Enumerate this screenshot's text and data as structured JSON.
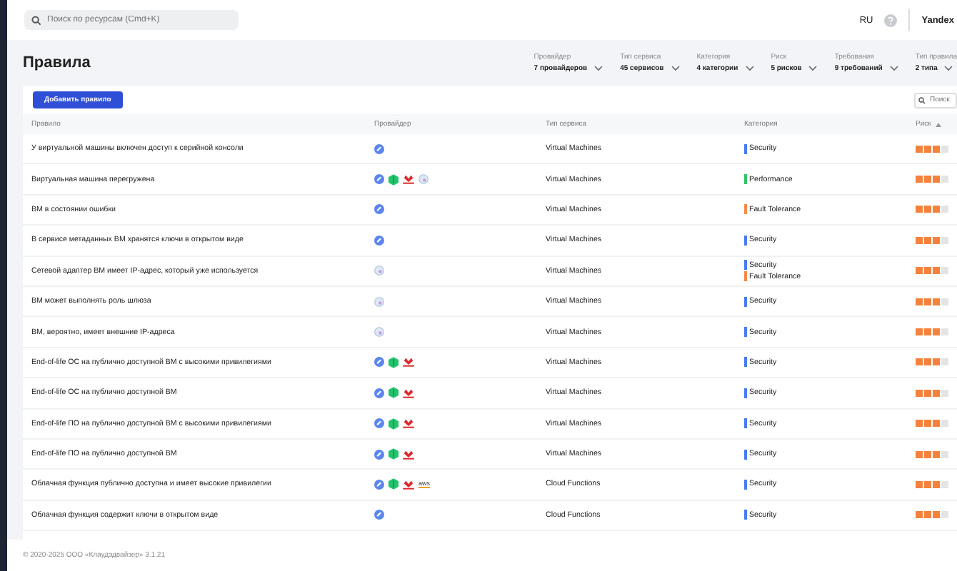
{
  "topbar": {
    "search": {
      "placeholder": "Поиск по ресурсам (Cmd+K)"
    },
    "language": "RU",
    "user": "Yandex"
  },
  "page": {
    "title": "Правила"
  },
  "filters": [
    {
      "label": "Провайдер",
      "value": "7 провайдеров"
    },
    {
      "label": "Тип сервиса",
      "value": "45 сервисов"
    },
    {
      "label": "Категория",
      "value": "4 категории"
    },
    {
      "label": "Риск",
      "value": "5 рисков"
    },
    {
      "label": "Требования",
      "value": "9 требований"
    },
    {
      "label": "Тип правила",
      "value": "2 типа"
    }
  ],
  "toolbar": {
    "add_button": "Добавить правило",
    "search": {
      "placeholder": "Поиск"
    }
  },
  "table": {
    "columns": [
      {
        "label": "Правило",
        "sorted": false
      },
      {
        "label": "Провайдер",
        "sorted": false
      },
      {
        "label": "Тип сервиса",
        "sorted": false
      },
      {
        "label": "Категория",
        "sorted": false
      },
      {
        "label": "Риск",
        "sorted": true
      }
    ],
    "rows": [
      {
        "rule": "У виртуальной машины включен доступ к серийной консоли",
        "providers": [
          {
            "kind": "blue"
          }
        ],
        "service": "Virtual Machines",
        "categories": [
          {
            "name": "Security",
            "color": "#4a7cf0"
          }
        ],
        "stars": 3
      },
      {
        "rule": "Виртуальная машина перегружена",
        "providers": [
          {
            "kind": "blue"
          },
          {
            "kind": "green"
          },
          {
            "kind": "red"
          },
          {
            "kind": "pale"
          }
        ],
        "service": "Virtual Machines",
        "categories": [
          {
            "name": "Performance",
            "color": "#35c46a"
          }
        ],
        "stars": 3
      },
      {
        "rule": "ВМ в состоянии ошибки",
        "providers": [
          {
            "kind": "blue"
          }
        ],
        "service": "Virtual Machines",
        "categories": [
          {
            "name": "Fault Tolerance",
            "color": "#f58a4b"
          }
        ],
        "stars": 3
      },
      {
        "rule": "В сервисе метаданных ВМ хранятся ключи в открытом виде",
        "providers": [
          {
            "kind": "blue"
          }
        ],
        "service": "Virtual Machines",
        "categories": [
          {
            "name": "Security",
            "color": "#4a7cf0"
          }
        ],
        "stars": 3
      },
      {
        "rule": "Сетевой адаптер ВМ имеет IP-адрес, который уже используется",
        "providers": [
          {
            "kind": "pale"
          }
        ],
        "service": "Virtual Machines",
        "categories": [
          {
            "name": "Security",
            "color": "#4a7cf0"
          },
          {
            "name": "Fault Tolerance",
            "color": "#f58a4b"
          }
        ],
        "stars": 3
      },
      {
        "rule": "ВМ может выполнять роль шлюза",
        "providers": [
          {
            "kind": "pale"
          }
        ],
        "service": "Virtual Machines",
        "categories": [
          {
            "name": "Security",
            "color": "#4a7cf0"
          }
        ],
        "stars": 3
      },
      {
        "rule": "ВМ, вероятно, имеет внешние IP-адреса",
        "providers": [
          {
            "kind": "pale"
          }
        ],
        "service": "Virtual Machines",
        "categories": [
          {
            "name": "Security",
            "color": "#4a7cf0"
          }
        ],
        "stars": 3
      },
      {
        "rule": "End-of-life ОС на публично доступной ВМ с высокими привилегиями",
        "providers": [
          {
            "kind": "blue"
          },
          {
            "kind": "green"
          },
          {
            "kind": "red"
          }
        ],
        "service": "Virtual Machines",
        "categories": [
          {
            "name": "Security",
            "color": "#4a7cf0"
          }
        ],
        "stars": 3
      },
      {
        "rule": "End-of-life ОС на публично доступной ВМ",
        "providers": [
          {
            "kind": "blue"
          },
          {
            "kind": "green"
          },
          {
            "kind": "red"
          }
        ],
        "service": "Virtual Machines",
        "categories": [
          {
            "name": "Security",
            "color": "#4a7cf0"
          }
        ],
        "stars": 3
      },
      {
        "rule": "End-of-life ПО на публично доступной ВМ с высокими привилегиями",
        "providers": [
          {
            "kind": "blue"
          },
          {
            "kind": "green"
          },
          {
            "kind": "red"
          }
        ],
        "service": "Virtual Machines",
        "categories": [
          {
            "name": "Security",
            "color": "#4a7cf0"
          }
        ],
        "stars": 3
      },
      {
        "rule": "End-of-life ПО на публично доступной ВМ",
        "providers": [
          {
            "kind": "blue"
          },
          {
            "kind": "green"
          },
          {
            "kind": "red"
          }
        ],
        "service": "Virtual Machines",
        "categories": [
          {
            "name": "Security",
            "color": "#4a7cf0"
          }
        ],
        "stars": 3
      },
      {
        "rule": "Облачная функция публично доступна и имеет высокие привилегии",
        "providers": [
          {
            "kind": "blue"
          },
          {
            "kind": "green"
          },
          {
            "kind": "red"
          },
          {
            "kind": "wordmark",
            "text": "aws"
          }
        ],
        "service": "Cloud Functions",
        "categories": [
          {
            "name": "Security",
            "color": "#4a7cf0"
          }
        ],
        "stars": 3
      },
      {
        "rule": "Облачная функция содержит ключи в открытом виде",
        "providers": [
          {
            "kind": "blue"
          }
        ],
        "service": "Cloud Functions",
        "categories": [
          {
            "name": "Security",
            "color": "#4a7cf0"
          }
        ],
        "stars": 3
      }
    ]
  },
  "footer": "© 2020-2025 ООО «Клаудэдвайзер» 3.1.21"
}
